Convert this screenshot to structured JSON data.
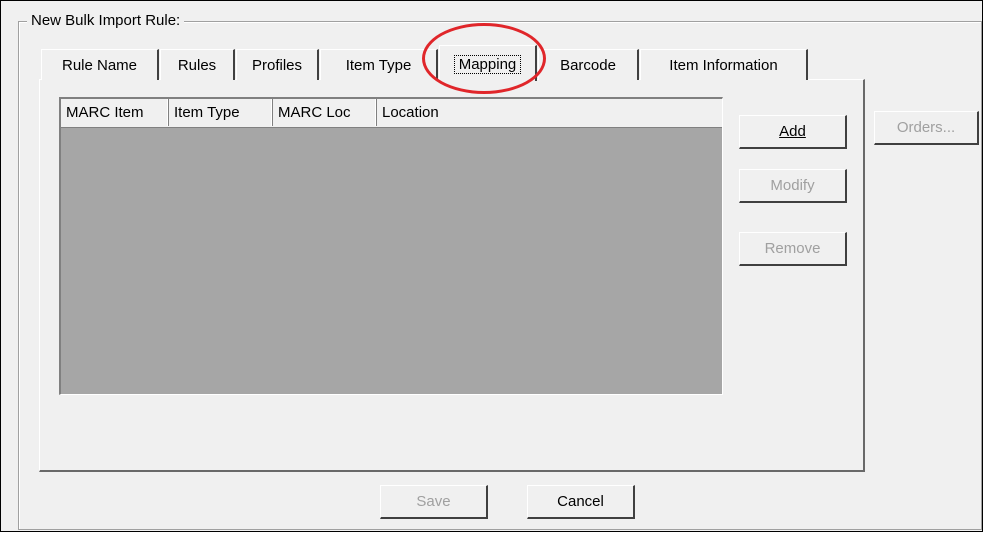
{
  "group": {
    "label": "New Bulk Import Rule:"
  },
  "tabs": [
    {
      "label": "Rule Name",
      "selected": false
    },
    {
      "label": "Rules",
      "selected": false
    },
    {
      "label": "Profiles",
      "selected": false
    },
    {
      "label": "Item Type",
      "selected": false
    },
    {
      "label": "Mapping",
      "selected": true
    },
    {
      "label": "Barcode",
      "selected": false
    },
    {
      "label": "Item Information",
      "selected": false
    }
  ],
  "table": {
    "columns": [
      "MARC Item",
      "Item Type",
      "MARC Loc",
      "Location"
    ],
    "rows": []
  },
  "buttons": {
    "add": {
      "label": "Add",
      "enabled": true
    },
    "modify": {
      "label": "Modify",
      "enabled": false
    },
    "remove": {
      "label": "Remove",
      "enabled": false
    },
    "orders": {
      "label": "Orders...",
      "enabled": false
    },
    "save": {
      "label": "Save",
      "enabled": false
    },
    "cancel": {
      "label": "Cancel",
      "enabled": true
    }
  },
  "colors": {
    "highlight_circle": "#e0262a",
    "list_background": "#a6a6a6",
    "window_background": "#f0f0f0"
  }
}
